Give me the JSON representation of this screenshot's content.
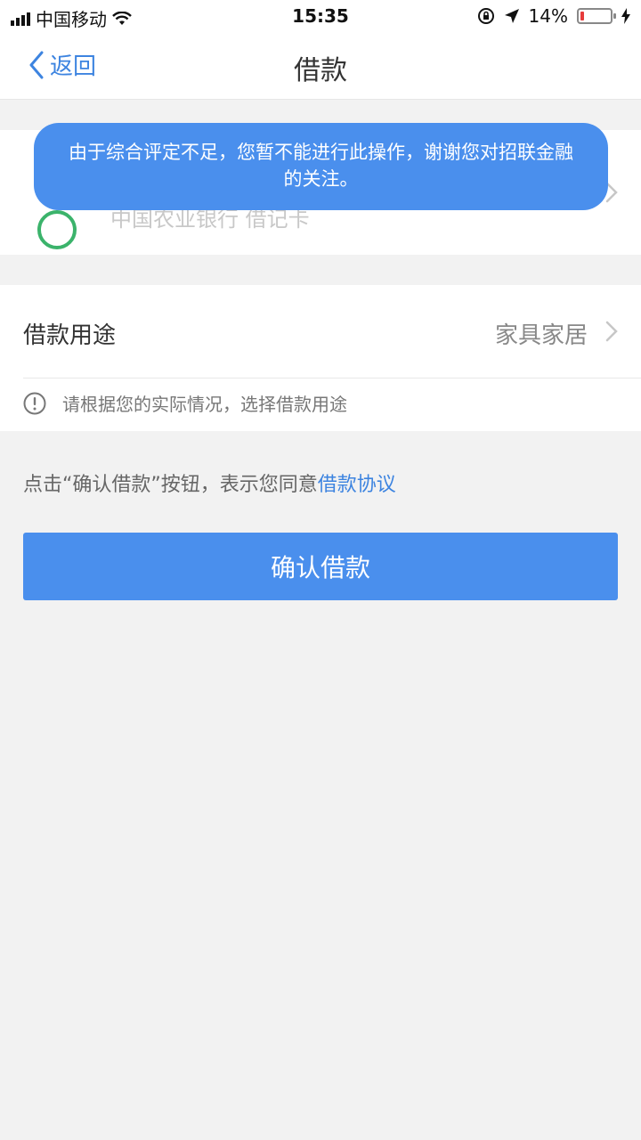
{
  "status_bar": {
    "carrier": "中国移动",
    "time": "15:35",
    "battery_percent": "14%",
    "battery_level": 0.14,
    "icons": [
      "signal-icon",
      "wifi-icon",
      "rotation-lock-icon",
      "location-icon",
      "battery-icon",
      "charging-icon"
    ]
  },
  "nav": {
    "back_label": "返回",
    "title": "借款"
  },
  "bank": {
    "name": "中国农业银行  借记卡",
    "accent_color": "#3bb36b"
  },
  "purpose": {
    "label": "借款用途",
    "value": "家具家居",
    "tip": "请根据您的实际情况，选择借款用途"
  },
  "agreement": {
    "prefix": "点击“确认借款”按钮，表示您同意",
    "link": "借款协议"
  },
  "confirm_button": {
    "label": "确认借款",
    "color": "#4a8fed"
  },
  "toast": {
    "message": "由于综合评定不足，您暂不能进行此操作，谢谢您对招联金融的关注。"
  },
  "colors": {
    "accent": "#3d84e0",
    "background": "#f2f2f2"
  }
}
